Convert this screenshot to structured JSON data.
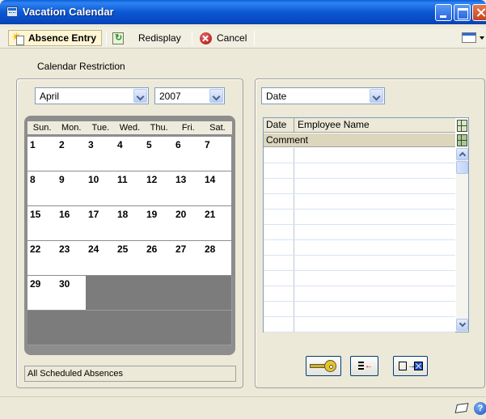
{
  "window": {
    "title": "Vacation Calendar"
  },
  "toolbar": {
    "absence_entry": "Absence Entry",
    "redisplay": "Redisplay",
    "cancel": "Cancel"
  },
  "filter": {
    "label": "Calendar Restriction",
    "month": "April",
    "year": "2007",
    "sort_by": "Date"
  },
  "calendar": {
    "weekdays": [
      "Sun.",
      "Mon.",
      "Tue.",
      "Wed.",
      "Thu.",
      "Fri.",
      "Sat."
    ],
    "days": [
      "1",
      "2",
      "3",
      "4",
      "5",
      "6",
      "7",
      "8",
      "9",
      "10",
      "11",
      "12",
      "13",
      "14",
      "15",
      "16",
      "17",
      "18",
      "19",
      "20",
      "21",
      "22",
      "23",
      "24",
      "25",
      "26",
      "27",
      "28",
      "29",
      "30"
    ]
  },
  "status": {
    "text": "All Scheduled Absences"
  },
  "grid": {
    "col_date": "Date",
    "col_employee": "Employee Name",
    "col_comment": "Comment"
  },
  "icons": {
    "window": "calendar-icon",
    "absence_entry": "new-entry-icon",
    "redisplay": "redisplay-icon",
    "cancel": "cancel-icon",
    "key": "key-icon",
    "list": "list-icon",
    "remove": "remove-icon",
    "note": "note-icon",
    "help": "help-icon"
  }
}
